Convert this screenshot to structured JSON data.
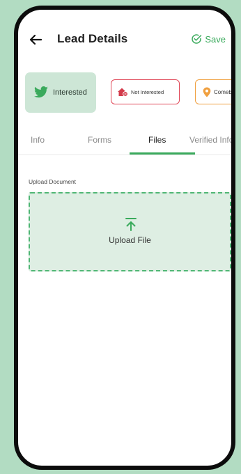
{
  "header": {
    "title": "Lead Details",
    "save_label": "Save",
    "back_icon": "arrow-left-icon",
    "save_icon": "check-circle-icon"
  },
  "status_chips": [
    {
      "label": "Interested",
      "icon": "bird-icon",
      "color": "#3aaa5c",
      "selected": true
    },
    {
      "label": "Not Interested",
      "icon": "house-icon",
      "color": "#e04757",
      "selected": false
    },
    {
      "label": "Comeback",
      "icon": "location-pin-icon",
      "color": "#f0a040",
      "selected": false
    }
  ],
  "tabs": [
    {
      "label": "Info",
      "active": false
    },
    {
      "label": "Forms",
      "active": false
    },
    {
      "label": "Files",
      "active": true
    },
    {
      "label": "Verified Info",
      "active": false
    }
  ],
  "upload": {
    "section_label": "Upload Document",
    "button_label": "Upload File",
    "icon": "upload-arrow-icon"
  },
  "colors": {
    "accent": "#3aaa5c",
    "background": "#b2dcc2",
    "chip_selected_bg": "#cde6d6",
    "upload_bg": "#deeee3",
    "not_interested": "#e04757",
    "comeback": "#f0a040"
  }
}
